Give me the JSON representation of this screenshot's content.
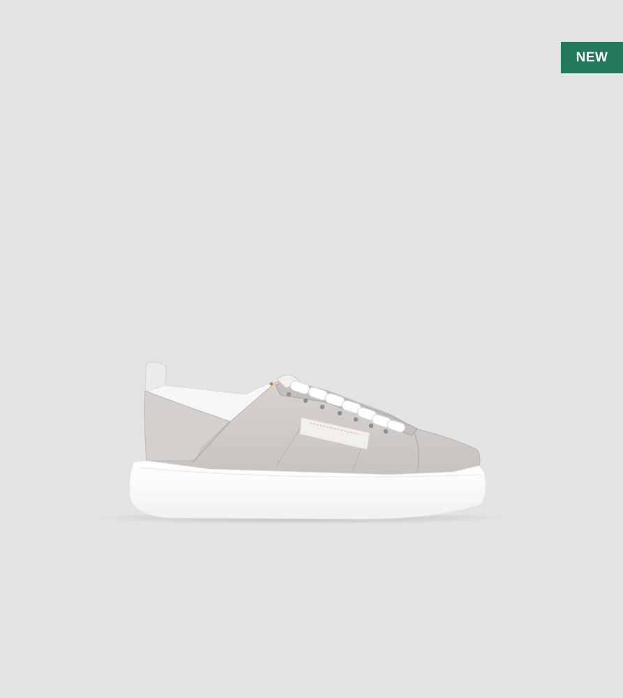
{
  "product": {
    "badge": {
      "label": "NEW",
      "background_color": "#23795a",
      "text_color": "#ffffff"
    },
    "image": {
      "subject": "sneaker",
      "upper_color": "#cdcac7",
      "sole_color": "#fbfbfb",
      "lace_color": "#ffffff",
      "background_color": "#e3e3e3"
    }
  }
}
